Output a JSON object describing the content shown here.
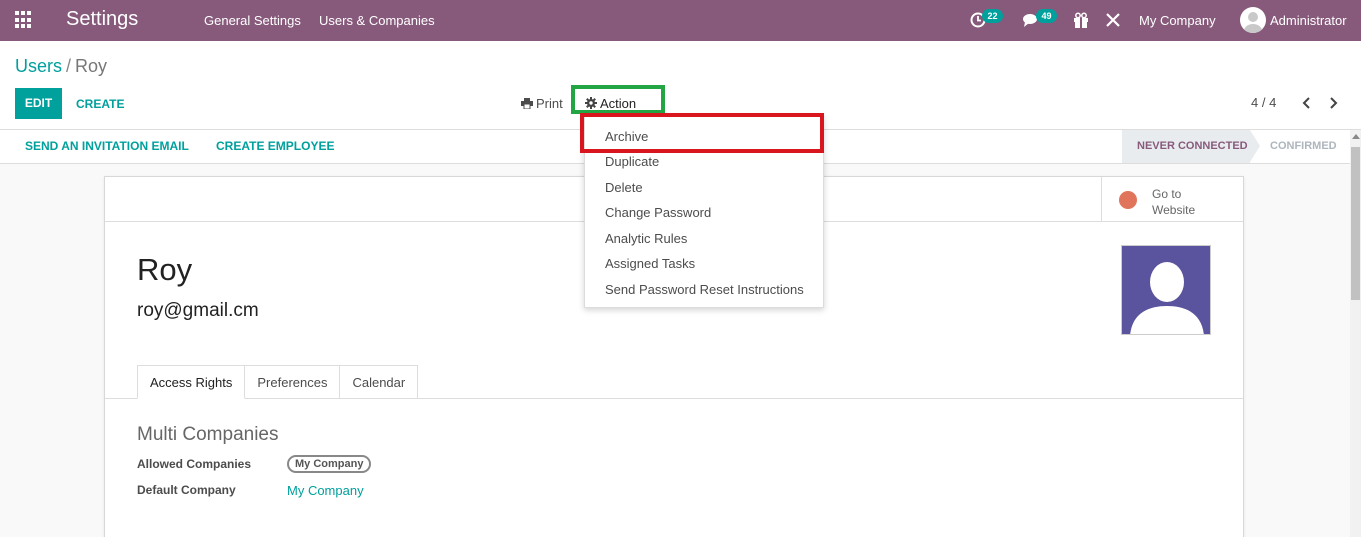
{
  "navbar": {
    "app_title": "Settings",
    "menu": [
      "General Settings",
      "Users & Companies"
    ],
    "activity_badge": "22",
    "messages_badge": "49",
    "company": "My Company",
    "user": "Administrator"
  },
  "breadcrumb": {
    "parent": "Users",
    "separator": "/",
    "current": "Roy"
  },
  "toolbar": {
    "edit_label": "EDIT",
    "create_label": "CREATE",
    "print_label": "Print",
    "action_label": "Action",
    "pager": "4 / 4"
  },
  "statusbar": {
    "buttons": [
      "SEND AN INVITATION EMAIL",
      "CREATE EMPLOYEE"
    ],
    "stages": [
      "NEVER CONNECTED",
      "CONFIRMED"
    ],
    "active_stage": "NEVER CONNECTED"
  },
  "action_menu": {
    "items": [
      "Archive",
      "Duplicate",
      "Delete",
      "Change Password",
      "Analytic Rules",
      "Assigned Tasks",
      "Send Password Reset Instructions"
    ],
    "highlighted": "Archive"
  },
  "form": {
    "website_button": [
      "Go to",
      "Website"
    ],
    "name": "Roy",
    "email": "roy@gmail.cm",
    "tabs": [
      "Access Rights",
      "Preferences",
      "Calendar"
    ],
    "active_tab": "Access Rights",
    "section_title": "Multi Companies",
    "allowed_companies_label": "Allowed Companies",
    "allowed_companies_tag": "My Company",
    "default_company_label": "Default Company",
    "default_company_value": "My Company"
  },
  "colors": {
    "navbar": "#875a7b",
    "accent": "#00a09d",
    "highlight_green": "#23a543",
    "highlight_red": "#d9161e",
    "avatar_bg": "#5a539d"
  },
  "icons": [
    "apps-grid-icon",
    "activity-clock-icon",
    "chat-icon",
    "gift-icon",
    "debug-tools-icon",
    "user-avatar-icon",
    "printer-icon",
    "gear-icon",
    "chevron-left-icon",
    "chevron-right-icon",
    "globe-icon",
    "person-silhouette-icon"
  ]
}
